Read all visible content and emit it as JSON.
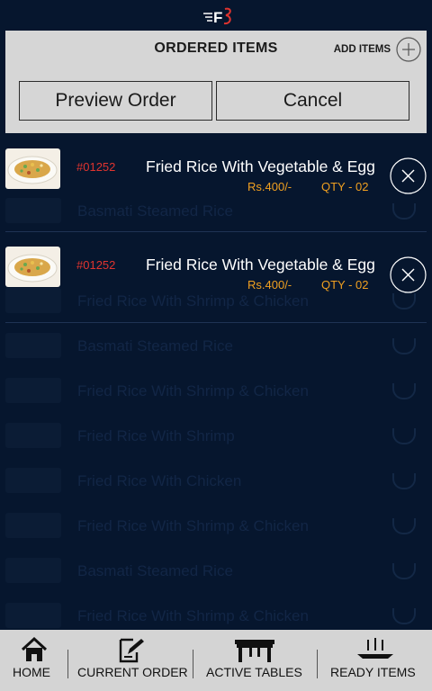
{
  "header": {
    "logo_text": "F"
  },
  "panel": {
    "title": "ORDERED ITEMS",
    "add_items_label": "ADD ITEMS",
    "preview_button": "Preview Order",
    "cancel_button": "Cancel"
  },
  "ordered_items": [
    {
      "code": "#01252",
      "name": "Fried Rice With Vegetable & Egg",
      "price": "Rs.400/-",
      "qty": "QTY - 02"
    },
    {
      "code": "#01252",
      "name": "Fried Rice With Vegetable & Egg",
      "price": "Rs.400/-",
      "qty": "QTY - 02"
    }
  ],
  "background_list": [
    {
      "name": "Basmati Steamed Rice",
      "meta": ""
    },
    {
      "name": "Fried Rice With Shrimp & Chicken",
      "meta": ""
    },
    {
      "name": "Basmati Steamed Rice",
      "meta": ""
    },
    {
      "name": "Fried Rice With Shrimp & Chicken",
      "meta": ""
    },
    {
      "name": "Fried Rice With Shrimp",
      "meta": ""
    },
    {
      "name": "Fried Rice With Chicken",
      "meta": ""
    },
    {
      "name": "Fried Rice With Shrimp & Chicken",
      "meta": ""
    },
    {
      "name": "Basmati Steamed Rice",
      "meta": ""
    },
    {
      "name": "Fried Rice With Shrimp & Chicken",
      "meta": ""
    }
  ],
  "bottom_nav": [
    {
      "label": "HOME",
      "icon": "home-icon"
    },
    {
      "label": "CURRENT ORDER",
      "icon": "edit-order-icon"
    },
    {
      "label": "ACTIVE TABLES",
      "icon": "table-icon"
    },
    {
      "label": "READY ITEMS",
      "icon": "serving-dish-icon"
    }
  ],
  "colors": {
    "background": "#06162e",
    "panel": "#d6d6d6",
    "code": "#e0342f",
    "price": "#f0a020"
  }
}
